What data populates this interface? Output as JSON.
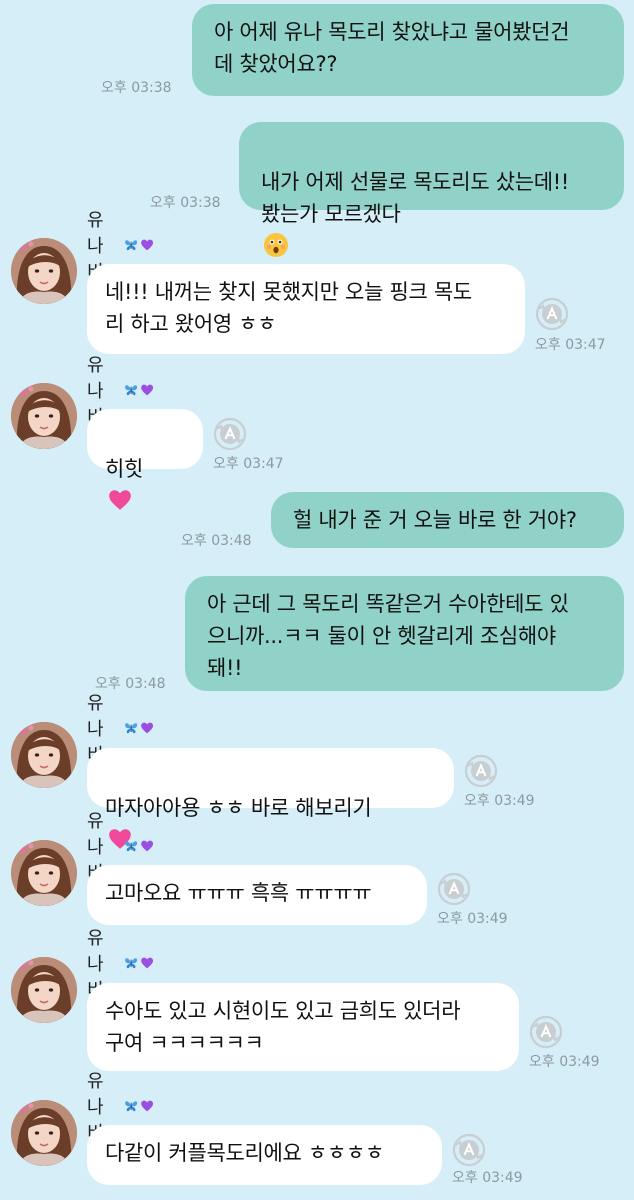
{
  "colors": {
    "background": "#d6eef7",
    "outgoing_bubble": "#91d2c8",
    "incoming_bubble": "#ffffff",
    "timestamp": "#8c9aa0"
  },
  "sender": {
    "name": "유나비",
    "badges": [
      "butterfly-icon",
      "purple-heart-icon"
    ]
  },
  "messages": [
    {
      "direction": "out",
      "text": "아 어제 유나 목도리 찾았냐고 물어봤던건\n데  찾았어요??",
      "time": "오후 03:38"
    },
    {
      "direction": "out",
      "text": "내가 어제 선물로 목도리도 샀는데!!\n봤는가 모르겠다",
      "time": "오후 03:38",
      "emoji": "astonished-face-icon"
    },
    {
      "direction": "in",
      "text": "네!!! 내꺼는 찾지 못했지만 오늘 핑크 목도\n리 하고 왔어영 ㅎㅎ",
      "time": "오후 03:47"
    },
    {
      "direction": "in",
      "text": "히힛",
      "time": "오후 03:47",
      "emoji": "pink-heart-icon"
    },
    {
      "direction": "out",
      "text": "헐 내가 준 거 오늘 바로 한 거야?",
      "time": "오후 03:48"
    },
    {
      "direction": "out",
      "text": "아 근데 그 목도리 똑같은거 수아한테도 있\n으니까...ㅋㅋ 둘이 안 헷갈리게 조심해야\n돼!!",
      "time": "오후 03:48"
    },
    {
      "direction": "in",
      "text": "마자아아용 ㅎㅎ 바로 해보리기",
      "time": "오후 03:49",
      "emoji": "heartbeat-icon"
    },
    {
      "direction": "in",
      "text": "고마오요 ㅠㅠㅠ 흑흑 ㅠㅠㅠㅠ",
      "time": "오후 03:49"
    },
    {
      "direction": "in",
      "text": "수아도 있고 시현이도 있고 금희도 있더라\n구여 ㅋㅋㅋㅋㅋㅋ",
      "time": "오후 03:49"
    },
    {
      "direction": "in",
      "text": "다같이 커플목도리에요 ㅎㅎㅎㅎ",
      "time": "오후 03:49"
    }
  ]
}
